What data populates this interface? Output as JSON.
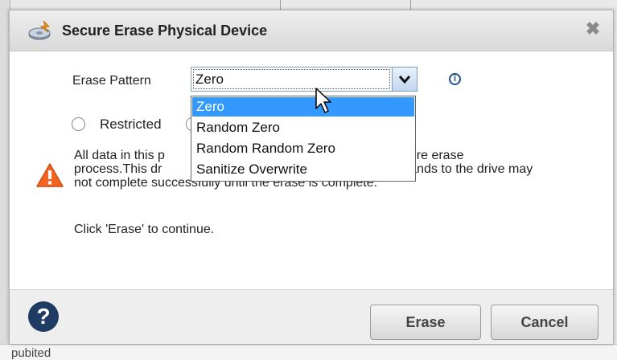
{
  "dialog": {
    "title": "Secure Erase Physical Device",
    "close_glyph": "✖",
    "erase_pattern": {
      "label": "Erase Pattern",
      "selected": "Zero",
      "options": [
        "Zero",
        "Random Zero",
        "Random Random Zero",
        "Sanitize Overwrite"
      ],
      "highlighted_index": 0
    },
    "info_glyph": "i",
    "radio": {
      "label": "Restricted",
      "checked": false
    },
    "warning": {
      "line1_left": "All data in this p",
      "line1_right": "g the secure erase",
      "line2_left": "process.This dr",
      "line2_right": "nands to the drive may",
      "line3": "not complete successfully until the erase is complete."
    },
    "continue_text": "Click 'Erase' to continue.",
    "buttons": {
      "erase": "Erase",
      "cancel": "Cancel"
    },
    "help_glyph": "?"
  },
  "background": {
    "bottom_text": "pubited"
  },
  "colors": {
    "selection": "#3399ff",
    "warning": "#f26522",
    "help": "#1f3b63",
    "title_icon": "#f7941d"
  },
  "icons": [
    "device-erase-icon",
    "close-icon",
    "info-icon",
    "warning-icon",
    "help-icon",
    "chevron-down-icon",
    "mouse-cursor-icon"
  ]
}
